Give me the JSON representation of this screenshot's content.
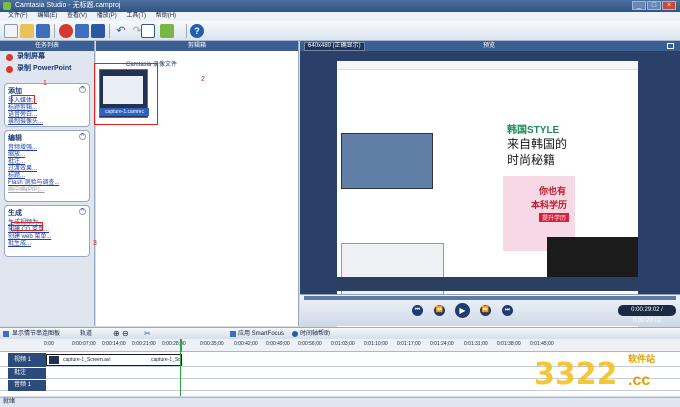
{
  "window": {
    "title": "Camtasia Studio - 无标题.camproj",
    "buttons": [
      "_",
      "□",
      "×"
    ]
  },
  "menu": [
    "文件(F)",
    "编辑(E)",
    "查看(V)",
    "播放(P)",
    "工具(T)",
    "帮助(H)"
  ],
  "task_panel": {
    "title": "任务列表",
    "record_screen": "录制屏幕",
    "record_ppt": "录制 PowerPoint",
    "add": {
      "title": "添加",
      "items": [
        "导入媒体...",
        "标题剪辑...",
        "语音旁白...",
        "录制摄像头..."
      ]
    },
    "edit": {
      "title": "编辑",
      "items": [
        "音频增强...",
        "缩放...",
        "批注...",
        "过渡效果...",
        "标题...",
        "Flash 测验与调查...",
        "画中画(PIP)..."
      ]
    },
    "produce": {
      "title": "生成",
      "items": [
        "生成视频为...",
        "创建 CD 菜单...",
        "创建 web 菜单...",
        "批生成..."
      ]
    }
  },
  "clip_bin": {
    "title": "剪辑箱",
    "group": "Camtasia 录像文件",
    "clip": "capture-1.camrec"
  },
  "preview": {
    "title": "预览",
    "size": "640x480 (正确显示)",
    "time": "0:00:29:02 / 0:00:29:02",
    "ad1": "韩国STYLE",
    "ad2": "来自韩国的",
    "ad3": "时尚秘籍",
    "ad4": "你也有",
    "ad5": "本科学历",
    "ad6": "提升学历"
  },
  "timeline": {
    "toolbar": {
      "storyboard": "显示情节串连图板",
      "tracks": "轨道",
      "smartfocus": "应用 SmartFocus",
      "help": "时间轴帮助"
    },
    "ruler": [
      "0:00",
      "0:00:07;00",
      "0:00:14;00",
      "0:00:21;00",
      "0:00:28;00",
      "0:00:35;00",
      "0:00:42;00",
      "0:00:49;00",
      "0:00:56;00",
      "0:01:03;00",
      "0:01:10;00",
      "0:01:17;00",
      "0:01:24;00",
      "0:01:31;00",
      "0:01:38;00",
      "0:01:45;00"
    ],
    "tracks": {
      "video": "视频 1",
      "callout": "批注",
      "audio": "音频 1"
    },
    "clip_a": "capture-1_Screen.avi",
    "clip_b": "capture-1_Sc"
  },
  "annotations": {
    "n1": "1",
    "n2": "2",
    "n3": "3"
  },
  "status": "就绪",
  "watermark": {
    "big": "3322",
    "small": "软件站",
    ".cc": ".cc"
  }
}
